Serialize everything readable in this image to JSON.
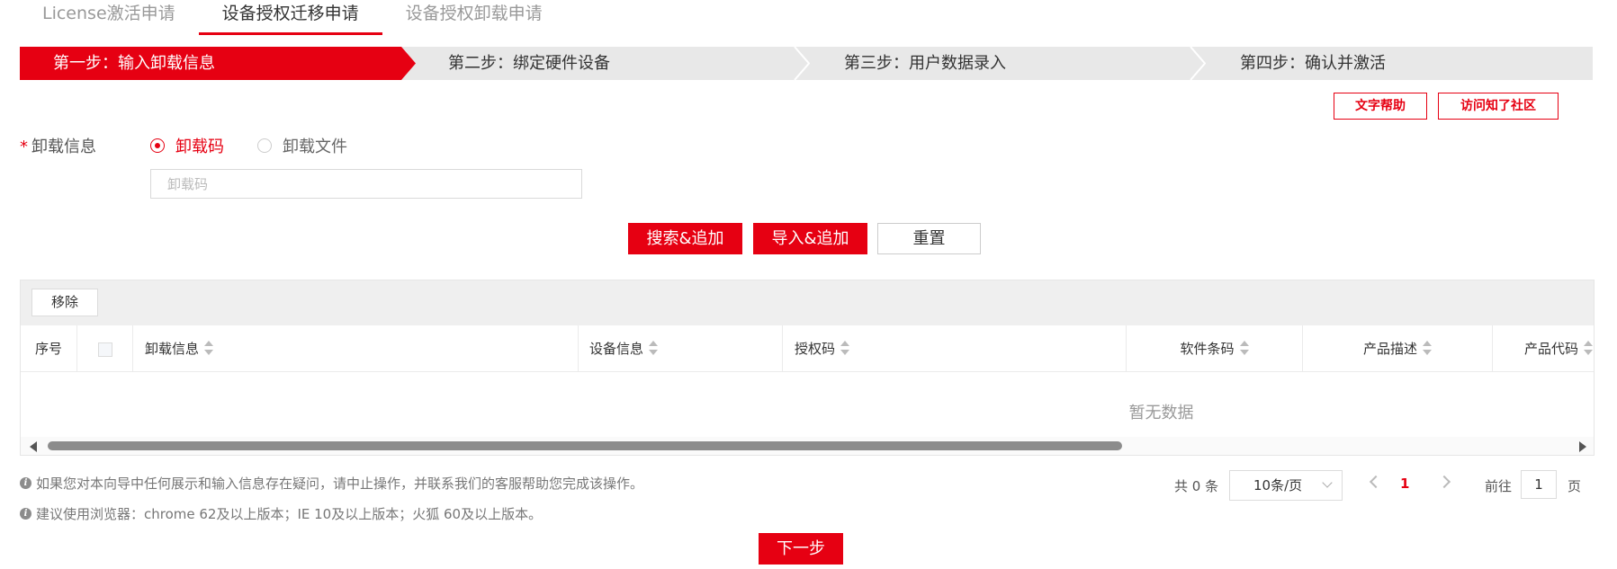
{
  "tabs": [
    {
      "label": "License激活申请"
    },
    {
      "label": "设备授权迁移申请"
    },
    {
      "label": "设备授权卸载申请"
    }
  ],
  "steps": [
    {
      "label": "第一步：输入卸载信息"
    },
    {
      "label": "第二步：绑定硬件设备"
    },
    {
      "label": "第三步：用户数据录入"
    },
    {
      "label": "第四步：确认并激活"
    }
  ],
  "help": {
    "text_help": "文字帮助",
    "community": "访问知了社区"
  },
  "form": {
    "required_mark": "*",
    "label": "卸载信息",
    "radio_code": "卸载码",
    "radio_file": "卸载文件",
    "input_placeholder": "卸载码",
    "input_value": ""
  },
  "actions": {
    "search_add": "搜索&追加",
    "import_add": "导入&追加",
    "reset": "重置"
  },
  "table": {
    "remove": "移除",
    "columns": [
      "序号",
      "卸载信息",
      "设备信息",
      "授权码",
      "软件条码",
      "产品描述",
      "产品代码"
    ],
    "empty_text": "暂无数据"
  },
  "notes": {
    "note1": "如果您对本向导中任何展示和输入信息存在疑问，请中止操作，并联系我们的客服帮助您完成该操作。",
    "note2": "建议使用浏览器：chrome 62及以上版本；IE 10及以上版本；火狐 60及以上版本。",
    "info_glyph": "i"
  },
  "pagination": {
    "total": "共 0 条",
    "page_size": "10条/页",
    "current_page": "1",
    "goto_label": "前往",
    "goto_value": "1",
    "page_unit": "页"
  },
  "next_button": "下一步",
  "colors": {
    "accent": "#e60012",
    "step_bg": "#e8e8e8",
    "toolbar_bg": "#efefef"
  }
}
